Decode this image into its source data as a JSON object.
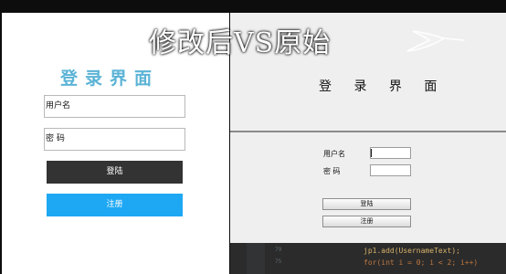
{
  "overlay": {
    "title": "修改后VS原始"
  },
  "modified": {
    "title": "登录界面",
    "username_value": "用户名",
    "password_value": "密  码",
    "login_label": "登陆",
    "register_label": "注册",
    "login_color": "#333333",
    "register_color": "#1ea8f4",
    "title_color": "#5bb3d6"
  },
  "original": {
    "title": "登 录 界 面",
    "username_label": "用户名",
    "password_label": "密  码",
    "login_label": "登陆",
    "register_label": "注册"
  },
  "code": {
    "line1": "jp1.add(UsernameText);",
    "line2": "for(int i = 0; i < 2; i++)",
    "line_num1": "79",
    "line_num2": "75"
  }
}
